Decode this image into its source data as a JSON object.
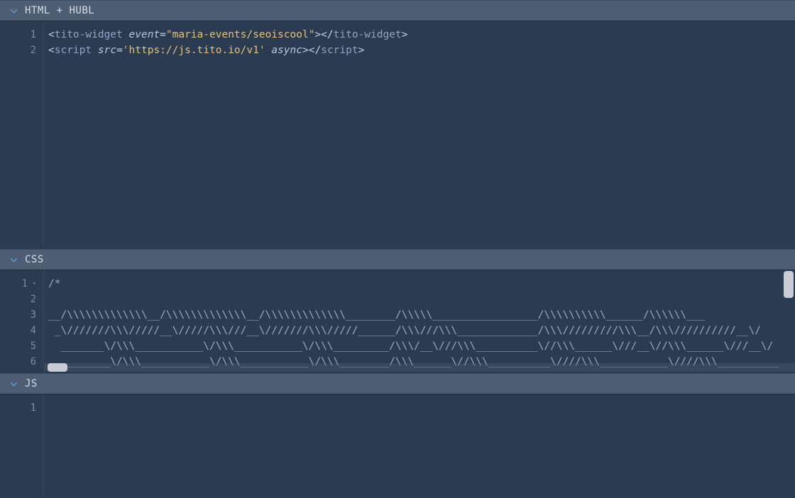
{
  "panels": {
    "html": {
      "title": "HTML + HUBL"
    },
    "css": {
      "title": "CSS"
    },
    "js": {
      "title": "JS"
    }
  },
  "html_code": {
    "lines": [
      "1",
      "2"
    ],
    "l1": {
      "open_lt": "<",
      "tag": "tito-widget",
      "sp": " ",
      "attr": "event",
      "eq": "=",
      "q1": "\"",
      "val": "maria-events/seoiscool",
      "q2": "\"",
      "open_gt": ">",
      "close_lt": "</",
      "close_tag": "tito-widget",
      "close_gt": ">"
    },
    "l2": {
      "open_lt": "<",
      "tag": "script",
      "sp": " ",
      "attr1": "src",
      "eq": "=",
      "q1": "'",
      "val": "https://js.tito.io/v1",
      "q2": "'",
      "sp2": " ",
      "attr2": "async",
      "open_gt": ">",
      "close_lt": "</",
      "close_tag": "script",
      "close_gt": ">"
    }
  },
  "css_code": {
    "lines": [
      "1",
      "2",
      "3",
      "4",
      "5",
      "6"
    ],
    "content": [
      "/*",
      "",
      "__/\\\\\\\\\\\\\\\\\\\\\\\\\\__/\\\\\\\\\\\\\\\\\\\\\\\\\\__/\\\\\\\\\\\\\\\\\\\\\\\\\\________/\\\\\\\\\\_________________/\\\\\\\\\\\\\\\\\\\\______/\\\\\\\\\\\\___",
      " _\\///////\\\\\\/////__\\/////\\\\\\///__\\///////\\\\\\/////______/\\\\\\///\\\\\\_____________/\\\\\\/////////\\\\\\__/\\\\\\//////////__\\/",
      "  _______\\/\\\\\\___________\\/\\\\\\___________\\/\\\\\\_________/\\\\\\/__\\///\\\\\\__________\\//\\\\\\______\\///__\\//\\\\\\______\\///__\\/",
      "   _______\\/\\\\\\___________\\/\\\\\\___________\\/\\\\\\________/\\\\\\______\\//\\\\\\__________\\////\\\\\\___________\\////\\\\\\__________"
    ]
  },
  "js_code": {
    "lines": [
      "1"
    ]
  }
}
